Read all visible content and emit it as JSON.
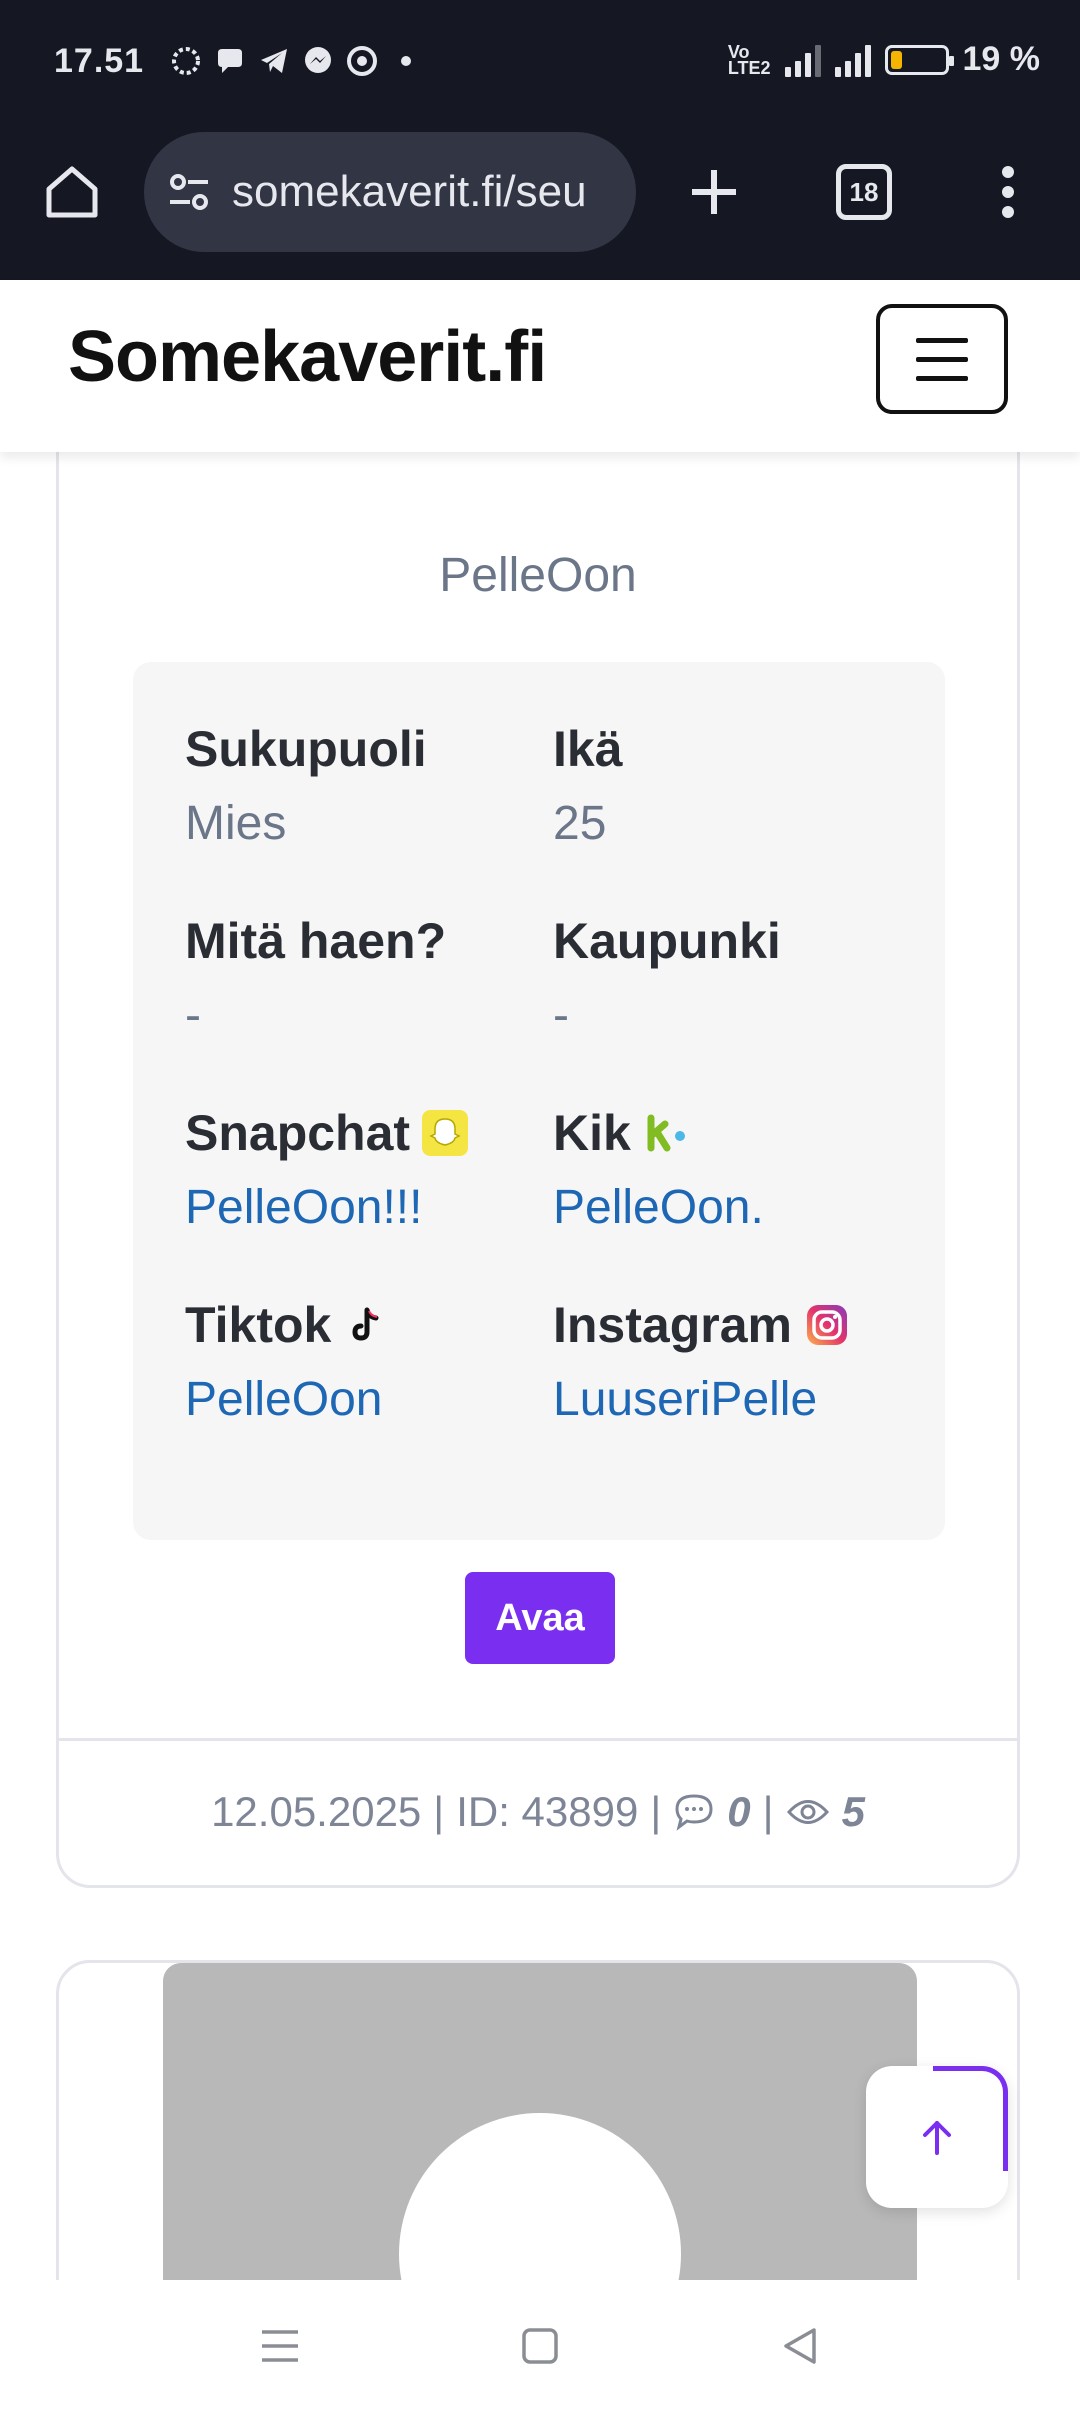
{
  "status_bar": {
    "time": "17.51",
    "battery": "19 %",
    "battery_level": 0.19,
    "notification_icons": [
      "signal-app-icon",
      "chat-icon",
      "telegram-icon",
      "messenger-icon",
      "chrome-icon",
      "dot-icon"
    ]
  },
  "browser": {
    "url": "somekaverit.fi/seu",
    "tab_count": "18"
  },
  "site": {
    "brand": "Somekaverit.fi",
    "menu_icon": "hamburger-menu-icon"
  },
  "profile": {
    "username": "PelleOon",
    "fields": {
      "gender_label": "Sukupuoli",
      "gender_value": "Mies",
      "age_label": "Ikä",
      "age_value": "25",
      "seeking_label": "Mitä haen?",
      "seeking_value": "-",
      "city_label": "Kaupunki",
      "city_value": "-",
      "snapchat_label": "Snapchat",
      "snapchat_value": "PelleOon!!!",
      "kik_label": "Kik",
      "kik_value": "PelleOon.",
      "tiktok_label": "Tiktok",
      "tiktok_value": "PelleOon",
      "instagram_label": "Instagram",
      "instagram_value": "LuuseriPelle"
    },
    "open_button": "Avaa",
    "meta": {
      "date": "12.05.2025",
      "id_text": "ID: 43899",
      "comments": "0",
      "views": "5"
    }
  },
  "colors": {
    "accent": "#7a2ff0",
    "link": "#1e67b4",
    "chrome_bg": "#151823"
  }
}
